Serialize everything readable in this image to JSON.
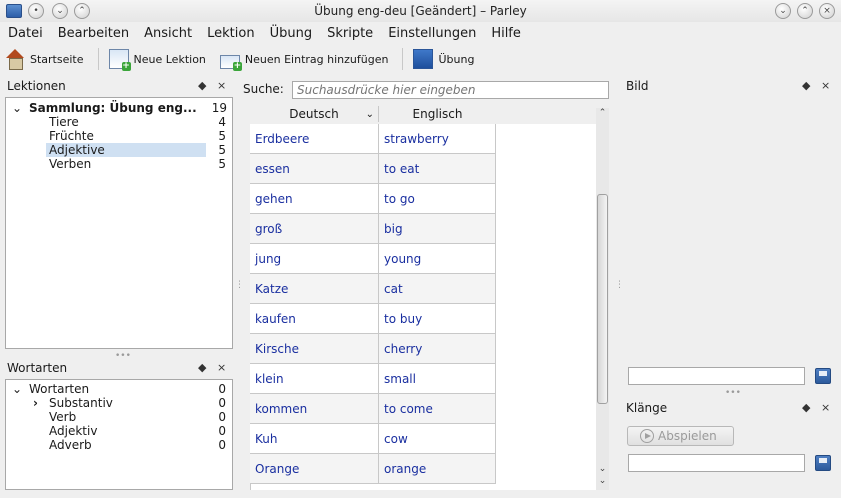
{
  "window": {
    "title": "Übung eng-deu [Geändert] – Parley",
    "btn_menu": "•",
    "btn_sticky": "⌄",
    "btn_raise": "⌃",
    "btn_minimize": "⌄",
    "btn_maximize": "⌃",
    "btn_close": "×"
  },
  "menu": [
    "Datei",
    "Bearbeiten",
    "Ansicht",
    "Lektion",
    "Übung",
    "Skripte",
    "Einstellungen",
    "Hilfe"
  ],
  "toolbar": {
    "home": "Startseite",
    "new_lesson": "Neue Lektion",
    "new_entry": "Neuen Eintrag hinzufügen",
    "practice": "Übung"
  },
  "lessons_panel": {
    "title": "Lektionen",
    "float": "◆",
    "close": "×",
    "root": {
      "label": "Sammlung: Übung eng...",
      "count": "19",
      "expander": "⌄"
    },
    "items": [
      {
        "label": "Tiere",
        "count": "4"
      },
      {
        "label": "Früchte",
        "count": "5"
      },
      {
        "label": "Adjektive",
        "count": "5"
      },
      {
        "label": "Verben",
        "count": "5"
      }
    ]
  },
  "wordtypes_panel": {
    "title": "Wortarten",
    "float": "◆",
    "close": "×",
    "root": {
      "label": "Wortarten",
      "count": "0",
      "expander": "⌄"
    },
    "items": [
      {
        "label": "Substantiv",
        "count": "0",
        "expander": "›"
      },
      {
        "label": "Verb",
        "count": "0"
      },
      {
        "label": "Adjektiv",
        "count": "0"
      },
      {
        "label": "Adverb",
        "count": "0"
      }
    ]
  },
  "search": {
    "label": "Suche:",
    "placeholder": "Suchausdrücke hier eingeben"
  },
  "table": {
    "columns": [
      "Deutsch",
      "Englisch"
    ],
    "sort_indicator": "⌄",
    "rows": [
      [
        "Erdbeere",
        "strawberry"
      ],
      [
        "essen",
        "to eat"
      ],
      [
        "gehen",
        "to go"
      ],
      [
        "groß",
        "big"
      ],
      [
        "jung",
        "young"
      ],
      [
        "Katze",
        "cat"
      ],
      [
        "kaufen",
        "to buy"
      ],
      [
        "Kirsche",
        "cherry"
      ],
      [
        "klein",
        "small"
      ],
      [
        "kommen",
        "to come"
      ],
      [
        "Kuh",
        "cow"
      ],
      [
        "Orange",
        "orange"
      ]
    ],
    "scroll_up": "⌃",
    "scroll_down": "⌄"
  },
  "image_panel": {
    "title": "Bild",
    "float": "◆",
    "close": "×"
  },
  "sounds_panel": {
    "title": "Klänge",
    "float": "◆",
    "close": "×",
    "play_label": "Abspielen"
  }
}
